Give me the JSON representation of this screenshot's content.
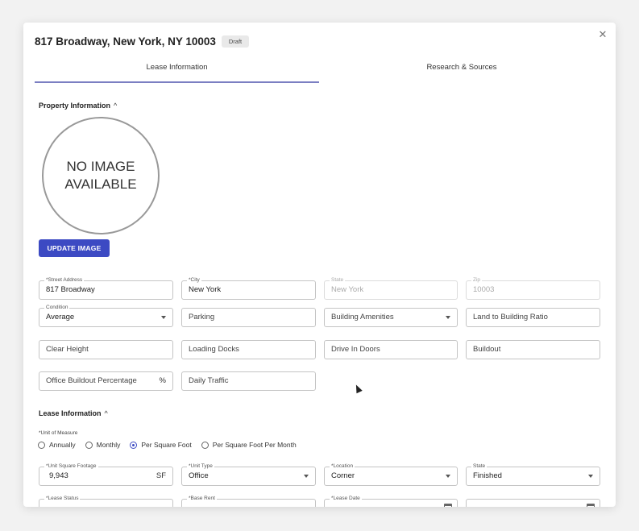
{
  "header": {
    "title": "817 Broadway, New York, NY 10003",
    "status_badge": "Draft",
    "close_icon": "close-icon"
  },
  "tabs": [
    {
      "label": "Lease Information",
      "active": true
    },
    {
      "label": "Research & Sources",
      "active": false
    }
  ],
  "property_section": {
    "heading": "Property Information",
    "no_image_line1": "NO IMAGE",
    "no_image_line2": "AVAILABLE",
    "update_button": "UPDATE IMAGE",
    "fields": {
      "street_address": {
        "label": "*Street Address",
        "value": "817 Broadway"
      },
      "city": {
        "label": "*City",
        "value": "New York"
      },
      "state": {
        "label": "State",
        "value": "New York",
        "disabled": true
      },
      "zip": {
        "label": "Zip",
        "value": "10003",
        "disabled": true
      },
      "condition": {
        "label": "Condition",
        "value": "Average"
      },
      "parking": {
        "placeholder": "Parking"
      },
      "building_amenities": {
        "placeholder": "Building Amenities"
      },
      "land_to_building_ratio": {
        "placeholder": "Land to Building Ratio"
      },
      "clear_height": {
        "placeholder": "Clear Height"
      },
      "loading_docks": {
        "placeholder": "Loading Docks"
      },
      "drive_in_doors": {
        "placeholder": "Drive In Doors"
      },
      "buildout": {
        "placeholder": "Buildout"
      },
      "office_buildout_percentage": {
        "placeholder": "Office Buildout Percentage",
        "suffix": "%"
      },
      "daily_traffic": {
        "placeholder": "Daily Traffic"
      }
    }
  },
  "lease_section": {
    "heading": "Lease Information",
    "unit_of_measure": {
      "label": "*Unit of Measure",
      "options": [
        "Annually",
        "Monthly",
        "Per Square Foot",
        "Per Square Foot Per Month"
      ],
      "selected": "Per Square Foot"
    },
    "fields": {
      "unit_square_footage": {
        "label": "*Unit Square Footage",
        "value": "9,943",
        "suffix": "SF"
      },
      "unit_type": {
        "label": "*Unit Type",
        "value": "Office"
      },
      "location": {
        "label": "*Location",
        "value": "Corner"
      },
      "state": {
        "label": "State",
        "value": "Finished"
      },
      "lease_status": {
        "label": "*Lease Status"
      },
      "base_rent": {
        "label": "*Base Rent"
      },
      "lease_date": {
        "label": "*Lease Date"
      }
    }
  },
  "colors": {
    "accent": "#3c4ac3",
    "tab_underline": "#7b7fc2"
  }
}
